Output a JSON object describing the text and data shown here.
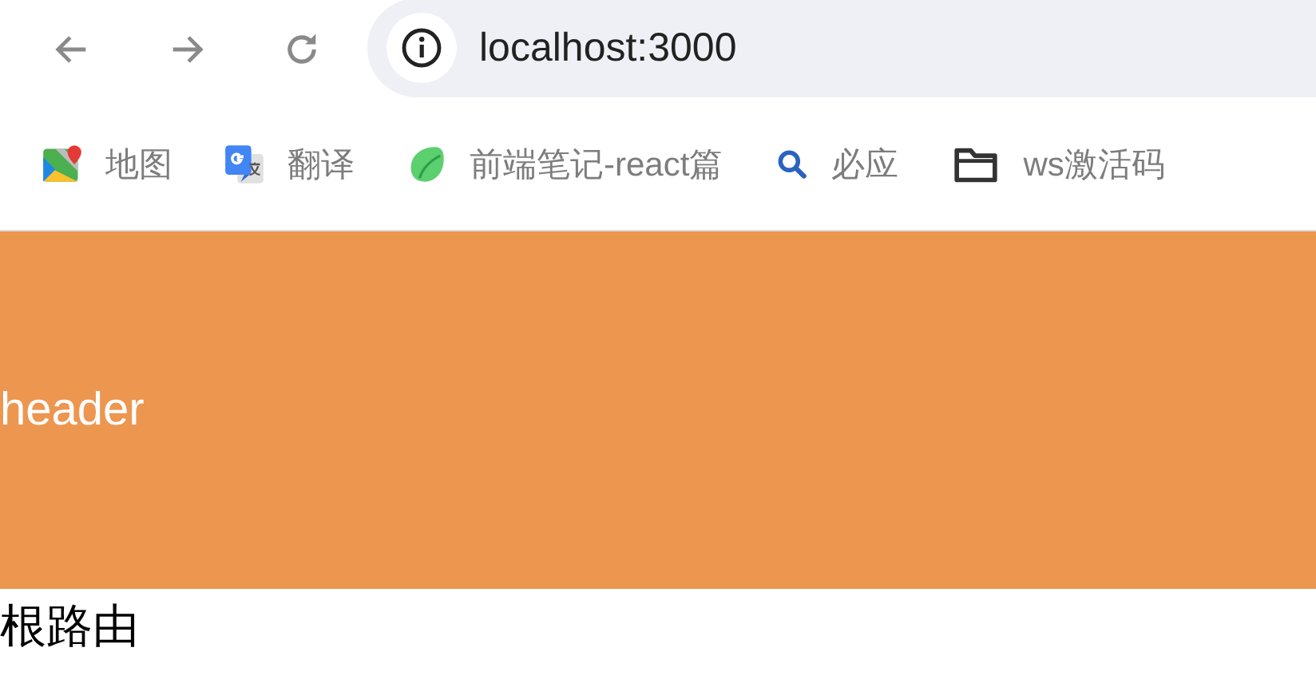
{
  "address_bar": {
    "url": "localhost:3000"
  },
  "bookmarks": [
    {
      "label": "地图",
      "kind": "maps"
    },
    {
      "label": "翻译",
      "kind": "translate"
    },
    {
      "label": "前端笔记-react篇",
      "kind": "leaf"
    },
    {
      "label": "必应",
      "kind": "search"
    },
    {
      "label": "ws激活码",
      "kind": "folder"
    }
  ],
  "page": {
    "header": "header",
    "content": "根路由"
  }
}
